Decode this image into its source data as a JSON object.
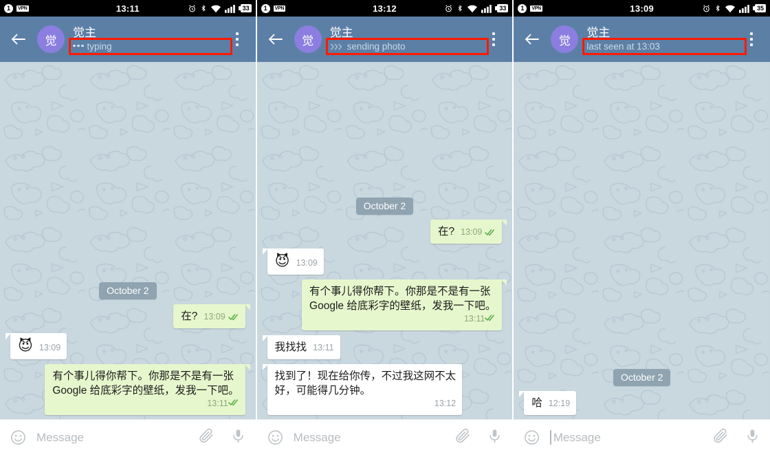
{
  "app": {
    "name": "Telegram",
    "accent_header": "#5c7fa6",
    "bubble_out": "#e7f7cd",
    "bubble_in": "#ffffff",
    "avatar_color": "#8b7ee0",
    "highlight_color": "#ff1a00",
    "chat_bg": "#c9d7df"
  },
  "panels": [
    {
      "id": "panel-typing",
      "statusbar": {
        "left_badge": "1",
        "vpn": "VPN",
        "clock": "13:11",
        "battery": "33",
        "icons": [
          "alarm-icon",
          "bluetooth-icon",
          "wifi-icon",
          "signal-icon",
          "battery-icon"
        ]
      },
      "header": {
        "back": "back-arrow-icon",
        "avatar_letter": "觉",
        "title": "觉主",
        "status": "typing",
        "status_icon": "typing-dots-icon",
        "menu": "overflow-menu-icon",
        "highlighted": true
      },
      "messages": [
        {
          "kind": "date",
          "text": "October 2"
        },
        {
          "kind": "out",
          "text": "在?",
          "time": "13:09",
          "ticks": "double-check-icon",
          "inline": true
        },
        {
          "kind": "in",
          "text": "😈",
          "time": "13:09",
          "emoji": true,
          "inline": true
        },
        {
          "kind": "out",
          "text": "有个事儿得你帮下。你那是不是有一张\nGoogle 给底彩字的壁纸，发我一下吧。",
          "time": "13:11",
          "ticks": "double-check-icon",
          "inline": false
        }
      ],
      "input": {
        "emoji_icon": "smiley-icon",
        "placeholder": "Message",
        "value": "",
        "caret": false,
        "attach_icon": "paperclip-icon",
        "mic_icon": "microphone-icon"
      }
    },
    {
      "id": "panel-sending-photo",
      "statusbar": {
        "left_badge": "1",
        "vpn": "VPN",
        "clock": "13:12",
        "battery": "33",
        "icons": [
          "alarm-icon",
          "bluetooth-icon",
          "wifi-icon",
          "signal-icon",
          "battery-icon"
        ]
      },
      "header": {
        "back": "back-arrow-icon",
        "avatar_letter": "觉",
        "title": "觉主",
        "status": "sending photo",
        "status_icon": "chevrons-right-icon",
        "menu": "overflow-menu-icon",
        "highlighted": true
      },
      "messages": [
        {
          "kind": "date",
          "text": "October 2"
        },
        {
          "kind": "out",
          "text": "在?",
          "time": "13:09",
          "ticks": "double-check-icon",
          "inline": true
        },
        {
          "kind": "in",
          "text": "😈",
          "time": "13:09",
          "emoji": true,
          "inline": true
        },
        {
          "kind": "out",
          "text": "有个事儿得你帮下。你那是不是有一张\nGoogle 给底彩字的壁纸，发我一下吧。",
          "time": "13:11",
          "ticks": "double-check-icon",
          "inline": false
        },
        {
          "kind": "in",
          "text": "我找找",
          "time": "13:11",
          "inline": true
        },
        {
          "kind": "in",
          "text": "找到了！现在给你传，不过我这网不太\n好，可能得几分钟。",
          "time": "13:12",
          "inline": false
        }
      ],
      "input": {
        "emoji_icon": "smiley-icon",
        "placeholder": "Message",
        "value": "",
        "caret": false,
        "attach_icon": "paperclip-icon",
        "mic_icon": "microphone-icon"
      }
    },
    {
      "id": "panel-last-seen",
      "statusbar": {
        "left_badge": "1",
        "vpn": "VPN",
        "clock": "13:09",
        "battery": "35",
        "icons": [
          "alarm-icon",
          "bluetooth-icon",
          "wifi-icon",
          "signal-icon",
          "battery-icon"
        ]
      },
      "header": {
        "back": "back-arrow-icon",
        "avatar_letter": "觉",
        "title": "觉主",
        "status": "last seen at 13:03",
        "status_icon": "none",
        "menu": "overflow-menu-icon",
        "highlighted": true
      },
      "messages": [
        {
          "kind": "date",
          "text": "October 2"
        },
        {
          "kind": "in",
          "text": "哈",
          "time": "12:19",
          "inline": true
        }
      ],
      "input": {
        "emoji_icon": "smiley-icon",
        "placeholder": "Message",
        "value": "",
        "caret": true,
        "attach_icon": "paperclip-icon",
        "mic_icon": "microphone-icon"
      }
    }
  ]
}
